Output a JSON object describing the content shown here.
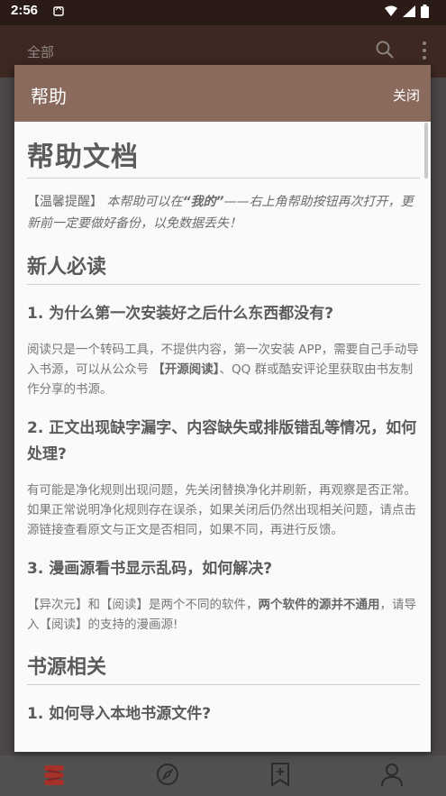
{
  "status_bar": {
    "time": "2:56"
  },
  "app_bar": {
    "title": "全部"
  },
  "dialog": {
    "title": "帮助",
    "close_label": "关闭",
    "doc_title": "帮助文档",
    "tip": {
      "tag": "【温馨提醒】",
      "text1": " 本帮助可以在",
      "mine": "“我的”",
      "text2": "——右上角帮助按钮再次打开，更新前一定要做好备份，以免数据丢失！"
    },
    "sections": {
      "newbie": "新人必读",
      "q1": "1. 为什么第一次安装好之后什么东西都没有?",
      "a1_pre": "阅读只是一个转码工具，不提供内容，第一次安装 APP，需要自己手动导入书源，可以从公众号 ",
      "a1_bold": "【开源阅读】",
      "a1_post": "、QQ 群或酷安评论里获取由书友制作分享的书源。",
      "q2": "2. 正文出现缺字漏字、内容缺失或排版错乱等情况，如何处理?",
      "a2": "有可能是净化规则出现问题，先关闭替换净化并刷新，再观察是否正常。如果正常说明净化规则存在误杀，如果关闭后仍然出现相关问题，请点击源链接查看原文与正文是否相同，如果不同，再进行反馈。",
      "q3": "3. 漫画源看书显示乱码，如何解决?",
      "a3_pre": "【异次元】和【阅读】是两个不同的软件，",
      "a3_bold": "两个软件的源并不通用",
      "a3_post": "，请导入【阅读】的支持的漫画源!",
      "source": "书源相关",
      "q4": "1. 如何导入本地书源文件?"
    }
  },
  "colors": {
    "dialog_header": "#8a6a5d",
    "status_bar": "#2b1b16",
    "app_bar": "#3d2922",
    "accent_red": "#b5332b"
  },
  "icons": [
    "search-icon",
    "more-vert-icon",
    "books-icon",
    "compass-icon",
    "bookmark-plus-icon",
    "person-icon"
  ]
}
